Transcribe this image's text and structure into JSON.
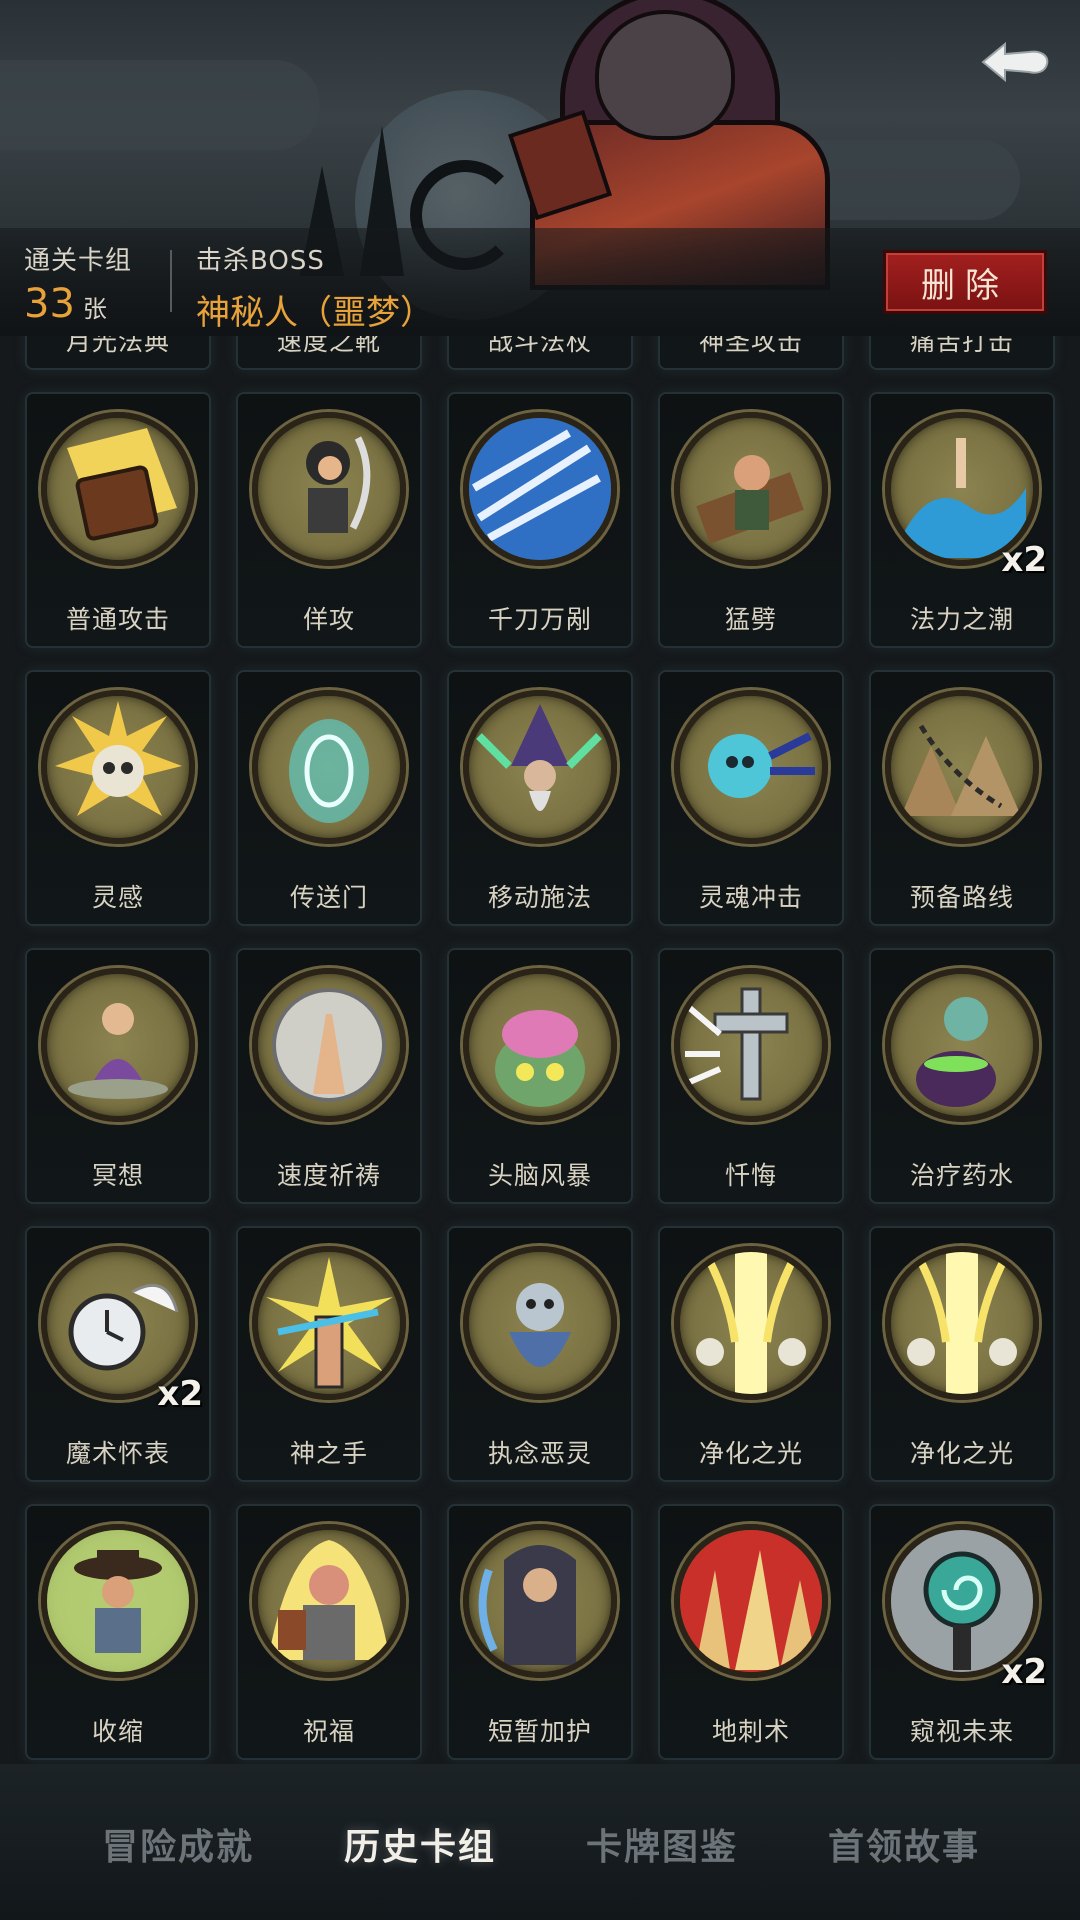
{
  "header": {
    "cleared_decks_label": "通关卡组",
    "cleared_decks_count": "33",
    "cleared_decks_unit": "张",
    "boss_label": "击杀BOSS",
    "boss_name": "神秘人（噩梦）",
    "delete_label": "删除"
  },
  "partial_row": [
    "月光法典",
    "速度之靴",
    "战斗法杖",
    "神圣攻击",
    "痛苦打击"
  ],
  "cards": [
    {
      "name": "普通攻击",
      "icon": "spellbook-icon",
      "count": ""
    },
    {
      "name": "佯攻",
      "icon": "rogue-icon",
      "count": ""
    },
    {
      "name": "千刀万剐",
      "icon": "blades-icon",
      "count": ""
    },
    {
      "name": "猛劈",
      "icon": "cleave-icon",
      "count": ""
    },
    {
      "name": "法力之潮",
      "icon": "wave-icon",
      "count": "x2"
    },
    {
      "name": "灵感",
      "icon": "brain-skull-icon",
      "count": ""
    },
    {
      "name": "传送门",
      "icon": "portal-icon",
      "count": ""
    },
    {
      "name": "移动施法",
      "icon": "wizard-icon",
      "count": ""
    },
    {
      "name": "灵魂冲击",
      "icon": "soul-blast-icon",
      "count": ""
    },
    {
      "name": "预备路线",
      "icon": "map-icon",
      "count": ""
    },
    {
      "name": "冥想",
      "icon": "meditation-icon",
      "count": ""
    },
    {
      "name": "速度祈祷",
      "icon": "prayer-icon",
      "count": ""
    },
    {
      "name": "头脑风暴",
      "icon": "brainstorm-icon",
      "count": ""
    },
    {
      "name": "忏悔",
      "icon": "cross-icon",
      "count": ""
    },
    {
      "name": "治疗药水",
      "icon": "potion-icon",
      "count": ""
    },
    {
      "name": "魔术怀表",
      "icon": "pocket-watch-icon",
      "count": "x2"
    },
    {
      "name": "神之手",
      "icon": "divine-hand-icon",
      "count": ""
    },
    {
      "name": "执念恶灵",
      "icon": "wraith-icon",
      "count": ""
    },
    {
      "name": "净化之光",
      "icon": "holy-light-icon",
      "count": ""
    },
    {
      "name": "净化之光",
      "icon": "holy-light-icon",
      "count": ""
    },
    {
      "name": "收缩",
      "icon": "shrink-icon",
      "count": ""
    },
    {
      "name": "祝福",
      "icon": "blessing-icon",
      "count": ""
    },
    {
      "name": "短暂加护",
      "icon": "shield-priest-icon",
      "count": ""
    },
    {
      "name": "地刺术",
      "icon": "spikes-icon",
      "count": ""
    },
    {
      "name": "窥视未来",
      "icon": "foresight-icon",
      "count": "x2"
    }
  ],
  "tabs": [
    {
      "label": "冒险成就",
      "active": false
    },
    {
      "label": "历史卡组",
      "active": true
    },
    {
      "label": "卡牌图鉴",
      "active": false
    },
    {
      "label": "首领故事",
      "active": false
    }
  ],
  "colors": {
    "accent_orange": "#e8a23a",
    "delete_red": "#a3201f",
    "card_art_bg": "#7c7444",
    "background": "#15191b"
  }
}
